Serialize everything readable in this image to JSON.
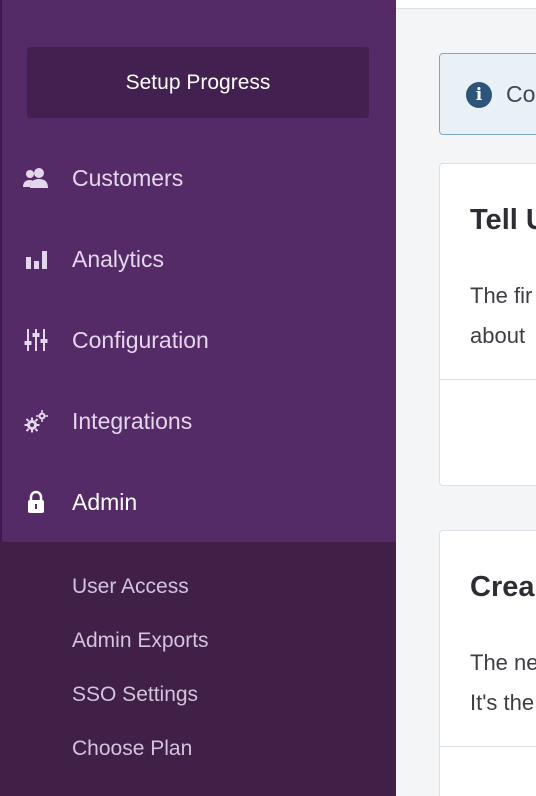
{
  "sidebar": {
    "setup_progress_label": "Setup Progress",
    "nav": [
      {
        "label": "Customers",
        "icon": "users-icon"
      },
      {
        "label": "Analytics",
        "icon": "bar-chart-icon"
      },
      {
        "label": "Configuration",
        "icon": "sliders-icon"
      },
      {
        "label": "Integrations",
        "icon": "gears-icon"
      },
      {
        "label": "Admin",
        "icon": "lock-icon",
        "active": true
      }
    ],
    "admin_subnav": [
      {
        "label": "User Access"
      },
      {
        "label": "Admin Exports"
      },
      {
        "label": "SSO Settings"
      },
      {
        "label": "Choose Plan"
      }
    ]
  },
  "main": {
    "alert": {
      "icon": "info-icon",
      "text": "Co"
    },
    "cards": [
      {
        "title": "Tell U",
        "body_line1": "The fir",
        "body_line2": "about"
      },
      {
        "title": "Crea",
        "body_line1": "The ne",
        "body_line2": "It's the"
      }
    ]
  },
  "colors": {
    "sidebar_bg": "#542a67",
    "setup_button_bg": "#42204f",
    "subnav_bg": "#412048",
    "alert_border": "#7fa7c8",
    "alert_icon": "#2d5579"
  }
}
